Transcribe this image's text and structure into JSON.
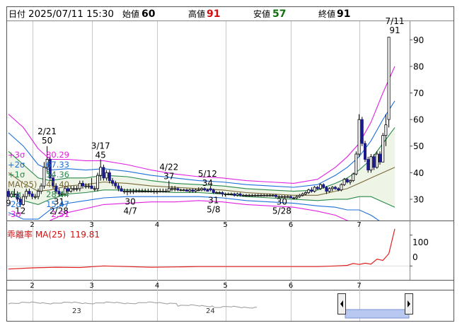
{
  "header": {
    "date_label": "日付",
    "datetime": "2025/07/11 15:30",
    "open_label": "始値",
    "open_value": "60",
    "high_label": "高値",
    "high_value": "91",
    "low_label": "安値",
    "low_value": "57",
    "close_label": "終値",
    "close_value": "91"
  },
  "colors": {
    "up": "#ffffff",
    "down": "#1a1a8c",
    "sigma3": "#e020e0",
    "sigma2": "#1e6fd8",
    "sigma1": "#2a8a4a",
    "ma": "#7a6a3a",
    "minus1": "#2a8a4a",
    "minus2": "#1e6fd8",
    "minus3": "#e020e0",
    "high_value": "#d01010",
    "low_value": "#107010",
    "deviation_line": "#e02020",
    "band_fill": "#eef4e6"
  },
  "legend": [
    {
      "label": "+3σ",
      "value": "80.29",
      "color": "#e020e0"
    },
    {
      "label": "+2σ",
      "value": "67.33",
      "color": "#1e6fd8"
    },
    {
      "label": "+1σ",
      "value": "54.36",
      "color": "#2a8a4a"
    },
    {
      "label": "MA(25)",
      "value": "41.40",
      "color": "#7a6a3a"
    },
    {
      "label": "-1σ",
      "value": "28.44",
      "color": "#2a8a4a"
    },
    {
      "label": "-2σ",
      "value": "15.47",
      "color": "#1e6fd8"
    },
    {
      "label": "-3σ",
      "value": "2.51",
      "color": "#e020e0"
    }
  ],
  "deviation": {
    "label": "乖離率 MA(25)",
    "value": "119.81",
    "ticks": [
      "100",
      "0"
    ]
  },
  "navigator": {
    "labels": [
      "23",
      "24"
    ]
  },
  "chart_data": {
    "type": "candlestick",
    "y_range": [
      22,
      97
    ],
    "y_ticks": [
      30,
      40,
      50,
      60,
      70,
      80,
      90
    ],
    "x_ticks": [
      "2",
      "3",
      "4",
      "5",
      "6",
      "7"
    ],
    "x_tick_index": [
      8,
      28,
      50,
      73,
      95,
      118
    ],
    "candles": [
      {
        "o": 33,
        "h": 34,
        "l": 30,
        "c": 31
      },
      {
        "o": 31,
        "h": 33,
        "l": 30.5,
        "c": 32
      },
      {
        "o": 32,
        "h": 34,
        "l": 31,
        "c": 32
      },
      {
        "o": 32,
        "h": 33,
        "l": 29,
        "c": 30
      },
      {
        "o": 30,
        "h": 31,
        "l": 27,
        "c": 28
      },
      {
        "o": 28,
        "h": 32,
        "l": 27.5,
        "c": 31
      },
      {
        "o": 31,
        "h": 34,
        "l": 30,
        "c": 33
      },
      {
        "o": 33,
        "h": 34,
        "l": 31,
        "c": 32
      },
      {
        "o": 32,
        "h": 33,
        "l": 30,
        "c": 31
      },
      {
        "o": 31,
        "h": 32,
        "l": 30,
        "c": 31
      },
      {
        "o": 31,
        "h": 34,
        "l": 30,
        "c": 33
      },
      {
        "o": 33,
        "h": 36,
        "l": 32,
        "c": 35
      },
      {
        "o": 35,
        "h": 44,
        "l": 34,
        "c": 42
      },
      {
        "o": 42,
        "h": 50,
        "l": 40,
        "c": 45
      },
      {
        "o": 45,
        "h": 46,
        "l": 37,
        "c": 38
      },
      {
        "o": 38,
        "h": 39,
        "l": 34,
        "c": 35
      },
      {
        "o": 35,
        "h": 36,
        "l": 32,
        "c": 33
      },
      {
        "o": 33,
        "h": 34,
        "l": 31,
        "c": 32
      },
      {
        "o": 32,
        "h": 33,
        "l": 31,
        "c": 32
      },
      {
        "o": 32,
        "h": 35,
        "l": 31,
        "c": 34
      },
      {
        "o": 34,
        "h": 35,
        "l": 32,
        "c": 33
      },
      {
        "o": 33,
        "h": 35,
        "l": 32.5,
        "c": 34
      },
      {
        "o": 34,
        "h": 35,
        "l": 33,
        "c": 34
      },
      {
        "o": 34,
        "h": 35,
        "l": 33,
        "c": 34
      },
      {
        "o": 34,
        "h": 37,
        "l": 33,
        "c": 36
      },
      {
        "o": 36,
        "h": 37,
        "l": 34,
        "c": 35
      },
      {
        "o": 35,
        "h": 36,
        "l": 34,
        "c": 35
      },
      {
        "o": 35,
        "h": 36,
        "l": 34,
        "c": 35
      },
      {
        "o": 35,
        "h": 38,
        "l": 34,
        "c": 34
      },
      {
        "o": 34,
        "h": 35,
        "l": 33,
        "c": 34
      },
      {
        "o": 34,
        "h": 40,
        "l": 33,
        "c": 39
      },
      {
        "o": 39,
        "h": 45,
        "l": 37,
        "c": 42
      },
      {
        "o": 42,
        "h": 43,
        "l": 37,
        "c": 38
      },
      {
        "o": 38,
        "h": 41,
        "l": 37,
        "c": 40
      },
      {
        "o": 40,
        "h": 41,
        "l": 36,
        "c": 37
      },
      {
        "o": 37,
        "h": 38,
        "l": 35,
        "c": 36
      },
      {
        "o": 36,
        "h": 37,
        "l": 34,
        "c": 35
      },
      {
        "o": 35,
        "h": 36,
        "l": 33,
        "c": 34
      },
      {
        "o": 34,
        "h": 35,
        "l": 33,
        "c": 33
      },
      {
        "o": 33,
        "h": 34,
        "l": 32,
        "c": 33
      },
      {
        "o": 33,
        "h": 34,
        "l": 31.5,
        "c": 33
      },
      {
        "o": 33,
        "h": 34,
        "l": 32,
        "c": 33
      },
      {
        "o": 33,
        "h": 34,
        "l": 32,
        "c": 33
      },
      {
        "o": 33,
        "h": 34,
        "l": 32.5,
        "c": 33
      },
      {
        "o": 33,
        "h": 34,
        "l": 32.5,
        "c": 33
      },
      {
        "o": 33,
        "h": 34,
        "l": 32.5,
        "c": 33
      },
      {
        "o": 33,
        "h": 34,
        "l": 32.5,
        "c": 33
      },
      {
        "o": 33,
        "h": 34,
        "l": 32.5,
        "c": 33
      },
      {
        "o": 33,
        "h": 34,
        "l": 32.5,
        "c": 33
      },
      {
        "o": 33,
        "h": 34,
        "l": 32,
        "c": 33
      },
      {
        "o": 33,
        "h": 34,
        "l": 32,
        "c": 33
      },
      {
        "o": 33,
        "h": 34,
        "l": 32.5,
        "c": 33
      },
      {
        "o": 33,
        "h": 34,
        "l": 32.5,
        "c": 33
      },
      {
        "o": 33,
        "h": 34,
        "l": 32.5,
        "c": 33
      },
      {
        "o": 33,
        "h": 37,
        "l": 32.5,
        "c": 34
      },
      {
        "o": 34,
        "h": 35,
        "l": 33,
        "c": 34
      },
      {
        "o": 34,
        "h": 35,
        "l": 33,
        "c": 34
      },
      {
        "o": 34,
        "h": 34.5,
        "l": 33,
        "c": 33.5
      },
      {
        "o": 33.5,
        "h": 34,
        "l": 33,
        "c": 33.5
      },
      {
        "o": 33.5,
        "h": 34,
        "l": 33,
        "c": 33.5
      },
      {
        "o": 33.5,
        "h": 34,
        "l": 33,
        "c": 33
      },
      {
        "o": 33,
        "h": 34,
        "l": 32.5,
        "c": 33.5
      },
      {
        "o": 33.5,
        "h": 34,
        "l": 32.5,
        "c": 33
      },
      {
        "o": 33,
        "h": 34,
        "l": 32.5,
        "c": 33.5
      },
      {
        "o": 33.5,
        "h": 34.5,
        "l": 33,
        "c": 33.5
      },
      {
        "o": 33.5,
        "h": 34.5,
        "l": 33,
        "c": 34
      },
      {
        "o": 34,
        "h": 34.5,
        "l": 33,
        "c": 33.5
      },
      {
        "o": 33.5,
        "h": 34,
        "l": 33,
        "c": 33
      },
      {
        "o": 34,
        "h": 35,
        "l": 33,
        "c": 33.5
      },
      {
        "o": 33.5,
        "h": 34,
        "l": 32,
        "c": 32.5
      },
      {
        "o": 32.5,
        "h": 33,
        "l": 32,
        "c": 32.5
      },
      {
        "o": 32.5,
        "h": 33,
        "l": 32,
        "c": 32.5
      },
      {
        "o": 32.5,
        "h": 33,
        "l": 31,
        "c": 32
      },
      {
        "o": 32,
        "h": 32.5,
        "l": 31,
        "c": 32
      },
      {
        "o": 32,
        "h": 32.5,
        "l": 31.5,
        "c": 32
      },
      {
        "o": 32,
        "h": 32.5,
        "l": 31.5,
        "c": 32
      },
      {
        "o": 32,
        "h": 32.5,
        "l": 31,
        "c": 31.5
      },
      {
        "o": 31.5,
        "h": 32.5,
        "l": 31,
        "c": 32
      },
      {
        "o": 32,
        "h": 32.5,
        "l": 31,
        "c": 31.5
      },
      {
        "o": 31.5,
        "h": 32,
        "l": 31,
        "c": 31.5
      },
      {
        "o": 31.5,
        "h": 32,
        "l": 31,
        "c": 31.5
      },
      {
        "o": 31.5,
        "h": 32,
        "l": 31,
        "c": 31.5
      },
      {
        "o": 31.5,
        "h": 32,
        "l": 31,
        "c": 31.5
      },
      {
        "o": 31.5,
        "h": 32,
        "l": 31,
        "c": 31.5
      },
      {
        "o": 31.5,
        "h": 32,
        "l": 31,
        "c": 31.5
      },
      {
        "o": 31.5,
        "h": 32,
        "l": 31,
        "c": 31.5
      },
      {
        "o": 31.5,
        "h": 32,
        "l": 31,
        "c": 31.5
      },
      {
        "o": 31.5,
        "h": 32,
        "l": 31,
        "c": 31.5
      },
      {
        "o": 31.5,
        "h": 32,
        "l": 31,
        "c": 31.5
      },
      {
        "o": 31.5,
        "h": 32,
        "l": 31,
        "c": 31.5
      },
      {
        "o": 31.5,
        "h": 32,
        "l": 30.5,
        "c": 31
      },
      {
        "o": 31,
        "h": 31.5,
        "l": 30.5,
        "c": 31
      },
      {
        "o": 31,
        "h": 31.5,
        "l": 30.5,
        "c": 31
      },
      {
        "o": 31,
        "h": 31.5,
        "l": 30.5,
        "c": 31
      },
      {
        "o": 31,
        "h": 31.5,
        "l": 30.5,
        "c": 31
      },
      {
        "o": 31,
        "h": 31.5,
        "l": 30.5,
        "c": 30.5
      },
      {
        "o": 30.5,
        "h": 31,
        "l": 30,
        "c": 30.5
      },
      {
        "o": 30.5,
        "h": 31.5,
        "l": 30,
        "c": 31
      },
      {
        "o": 31,
        "h": 32,
        "l": 30.5,
        "c": 31.5
      },
      {
        "o": 31.5,
        "h": 32.5,
        "l": 31,
        "c": 32
      },
      {
        "o": 32,
        "h": 33,
        "l": 31.5,
        "c": 32.5
      },
      {
        "o": 32.5,
        "h": 34,
        "l": 32,
        "c": 33.5
      },
      {
        "o": 33.5,
        "h": 34.5,
        "l": 32.5,
        "c": 33
      },
      {
        "o": 33,
        "h": 35,
        "l": 32.5,
        "c": 34.5
      },
      {
        "o": 34.5,
        "h": 35,
        "l": 33.5,
        "c": 34
      },
      {
        "o": 34,
        "h": 36,
        "l": 33.5,
        "c": 35.5
      },
      {
        "o": 35.5,
        "h": 36,
        "l": 34,
        "c": 34.5
      },
      {
        "o": 34.5,
        "h": 35,
        "l": 32,
        "c": 33
      },
      {
        "o": 33,
        "h": 34.5,
        "l": 32.5,
        "c": 34
      },
      {
        "o": 34,
        "h": 35,
        "l": 33,
        "c": 34.5
      },
      {
        "o": 34.5,
        "h": 35,
        "l": 33.5,
        "c": 34
      },
      {
        "o": 34,
        "h": 34.5,
        "l": 33,
        "c": 33.5
      },
      {
        "o": 33.5,
        "h": 36,
        "l": 33,
        "c": 35.5
      },
      {
        "o": 35.5,
        "h": 38,
        "l": 35,
        "c": 37.5
      },
      {
        "o": 37.5,
        "h": 38,
        "l": 36,
        "c": 36.5
      },
      {
        "o": 36.5,
        "h": 37.5,
        "l": 35.5,
        "c": 37
      },
      {
        "o": 37,
        "h": 40,
        "l": 36.5,
        "c": 39.5
      },
      {
        "o": 39.5,
        "h": 48,
        "l": 39,
        "c": 47
      },
      {
        "o": 47,
        "h": 62,
        "l": 46,
        "c": 60
      },
      {
        "o": 60,
        "h": 61,
        "l": 50,
        "c": 51
      },
      {
        "o": 51,
        "h": 52,
        "l": 44,
        "c": 45
      },
      {
        "o": 45,
        "h": 46,
        "l": 40,
        "c": 41
      },
      {
        "o": 41,
        "h": 47,
        "l": 40,
        "c": 46
      },
      {
        "o": 46,
        "h": 47,
        "l": 41,
        "c": 42
      },
      {
        "o": 42,
        "h": 48,
        "l": 41.5,
        "c": 47
      },
      {
        "o": 47,
        "h": 48,
        "l": 43,
        "c": 44
      },
      {
        "o": 44,
        "h": 55,
        "l": 44,
        "c": 54
      },
      {
        "o": 54,
        "h": 62,
        "l": 50,
        "c": 58
      },
      {
        "o": 60,
        "h": 91,
        "l": 57,
        "c": 91
      }
    ],
    "annotations": [
      {
        "text": "9",
        "i": 0,
        "v": 27.5,
        "pos": "below"
      },
      {
        "text": "12",
        "i": 4,
        "v": 24.5,
        "pos": "below"
      },
      {
        "text": "2/21",
        "i": 13,
        "v": 54.5,
        "pos": "above"
      },
      {
        "text": "50",
        "i": 13,
        "v": 51,
        "pos": "above"
      },
      {
        "text": "31",
        "i": 17,
        "v": 28,
        "pos": "below"
      },
      {
        "text": "2/28",
        "i": 17,
        "v": 24.5,
        "pos": "below"
      },
      {
        "text": "3/17",
        "i": 31,
        "v": 49,
        "pos": "above"
      },
      {
        "text": "45",
        "i": 31,
        "v": 45.5,
        "pos": "above"
      },
      {
        "text": "30",
        "i": 41,
        "v": 28,
        "pos": "below"
      },
      {
        "text": "4/7",
        "i": 41,
        "v": 24.5,
        "pos": "below"
      },
      {
        "text": "4/22",
        "i": 54,
        "v": 41,
        "pos": "above"
      },
      {
        "text": "37",
        "i": 54,
        "v": 37.5,
        "pos": "above"
      },
      {
        "text": "5/12",
        "i": 67,
        "v": 38.5,
        "pos": "above"
      },
      {
        "text": "34",
        "i": 67,
        "v": 35,
        "pos": "above"
      },
      {
        "text": "31",
        "i": 69,
        "v": 28.5,
        "pos": "below"
      },
      {
        "text": "5/8",
        "i": 69,
        "v": 25,
        "pos": "below"
      },
      {
        "text": "30",
        "i": 92,
        "v": 28,
        "pos": "below"
      },
      {
        "text": "5/28",
        "i": 92,
        "v": 24.5,
        "pos": "below"
      },
      {
        "text": "7/11",
        "i": 130,
        "v": 96,
        "pos": "above"
      },
      {
        "text": "91",
        "i": 130,
        "v": 92.5,
        "pos": "above"
      }
    ],
    "bands": {
      "index": [
        0,
        5,
        10,
        14,
        20,
        26,
        32,
        40,
        48,
        56,
        64,
        72,
        80,
        88,
        96,
        104,
        110,
        114,
        118,
        122,
        126,
        130
      ],
      "ma": [
        40,
        36,
        33,
        33.5,
        35,
        35.5,
        36.5,
        36,
        35,
        34.5,
        34,
        33.5,
        32.5,
        32,
        31.5,
        31.5,
        33,
        34,
        36,
        38,
        40,
        42
      ],
      "plus1": [
        48,
        43,
        38,
        37,
        38,
        38,
        39,
        38.5,
        37,
        36,
        35.5,
        35,
        34,
        33.5,
        33,
        33.5,
        36,
        38,
        41,
        45,
        51,
        57
      ],
      "plus2": [
        55,
        50,
        43,
        41,
        41.5,
        41,
        41.5,
        40.5,
        39,
        38,
        37,
        36.5,
        35.5,
        35,
        34.5,
        35.5,
        39,
        42,
        46,
        52,
        60,
        67
      ],
      "plus3": [
        62,
        57,
        49,
        45,
        45,
        44.5,
        44.5,
        43,
        41,
        39.5,
        38.5,
        38,
        37,
        36.5,
        36,
        37.5,
        42,
        46,
        51,
        59,
        70,
        80
      ],
      "minus1": [
        32,
        29.5,
        28,
        30,
        32,
        32.5,
        33.5,
        33.5,
        33,
        32.5,
        32.5,
        32,
        31,
        30.5,
        30,
        29.5,
        30,
        30,
        31,
        31,
        29,
        27
      ],
      "minus2": [
        25,
        22.5,
        22.5,
        26,
        28.5,
        29.5,
        30.5,
        31,
        31,
        31,
        31,
        30.5,
        29.5,
        29,
        28.5,
        27.5,
        27,
        26,
        26,
        24,
        21,
        16
      ],
      "minus3": [
        18,
        15.5,
        17,
        22,
        25,
        26.5,
        28,
        28.5,
        29,
        29,
        29.5,
        29,
        28,
        27.5,
        27,
        25.5,
        24,
        22,
        21,
        17,
        12,
        5
      ]
    },
    "deviation_line": {
      "index": [
        0,
        8,
        16,
        24,
        32,
        40,
        48,
        56,
        64,
        72,
        80,
        88,
        96,
        104,
        110,
        114,
        116,
        118,
        120,
        122,
        124,
        126,
        128,
        130
      ],
      "values": [
        -10,
        -6,
        -4,
        -5,
        0,
        -2,
        -4,
        -3,
        -2,
        -2,
        -2,
        -2,
        -2,
        -2,
        0,
        2,
        8,
        5,
        9,
        6,
        22,
        18,
        40,
        120
      ],
      "range": [
        -45,
        145
      ]
    }
  }
}
